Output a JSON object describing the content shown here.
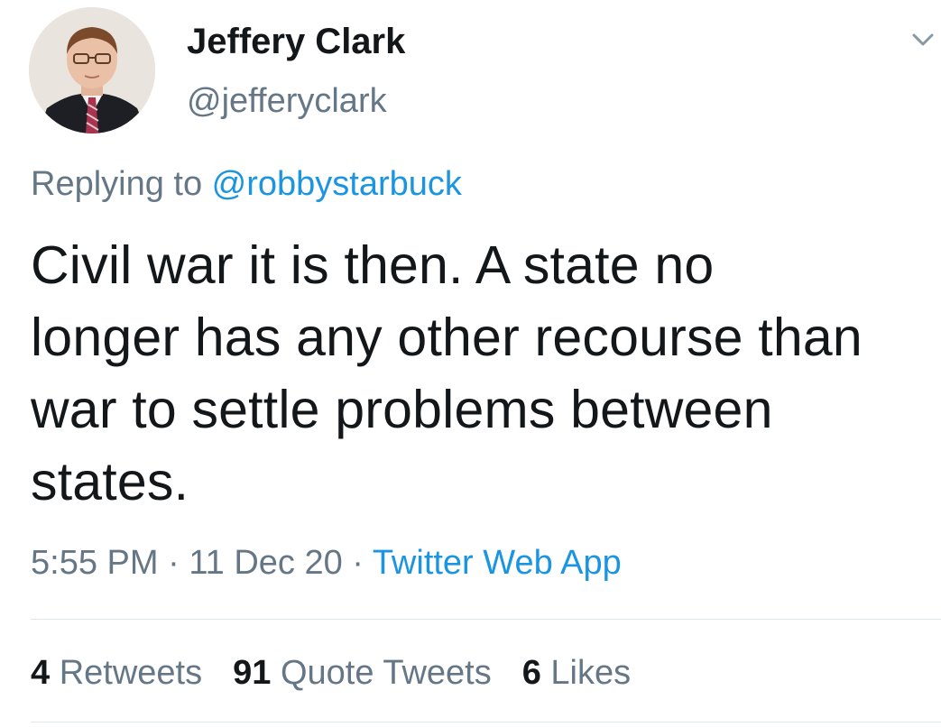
{
  "tweet": {
    "author": {
      "display_name": "Jeffery Clark",
      "handle": "@jefferyclark"
    },
    "replying_prefix": "Replying to ",
    "replying_to": "@robbystarbuck",
    "text_lines": [
      "Civil war it is then. A state no",
      "longer has any other recourse than",
      "war to settle problems between",
      "states."
    ],
    "time": "5:55 PM",
    "date": "11 Dec 20",
    "separator": " · ",
    "source": "Twitter Web App",
    "stats": {
      "retweets_count": "4",
      "retweets_label": " Retweets",
      "quote_tweets_count": "91",
      "quote_tweets_label": " Quote Tweets",
      "likes_count": "6",
      "likes_label": " Likes"
    },
    "menu_icon": "chevron-down-icon",
    "colors": {
      "text": "#14171a",
      "secondary": "#657786",
      "link": "#1b95e0",
      "divider": "#e1e8ed"
    }
  }
}
